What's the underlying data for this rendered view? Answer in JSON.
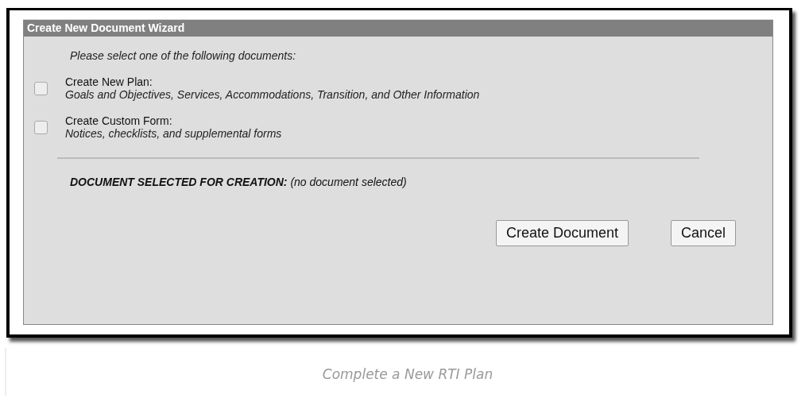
{
  "dialog": {
    "title": "Create New Document Wizard",
    "instruction": "Please select one of the following documents:",
    "options": [
      {
        "label": "Create New Plan:",
        "description": "Goals and Objectives, Services, Accommodations, Transition, and Other Information",
        "checked": false
      },
      {
        "label": "Create Custom Form:",
        "description": "Notices, checklists, and supplemental forms",
        "checked": false
      }
    ],
    "selection_label": "DOCUMENT SELECTED FOR CREATION:",
    "selection_value": "(no document selected)",
    "buttons": [
      "Create Document",
      "Cancel"
    ]
  },
  "caption": "Complete a New RTI Plan"
}
